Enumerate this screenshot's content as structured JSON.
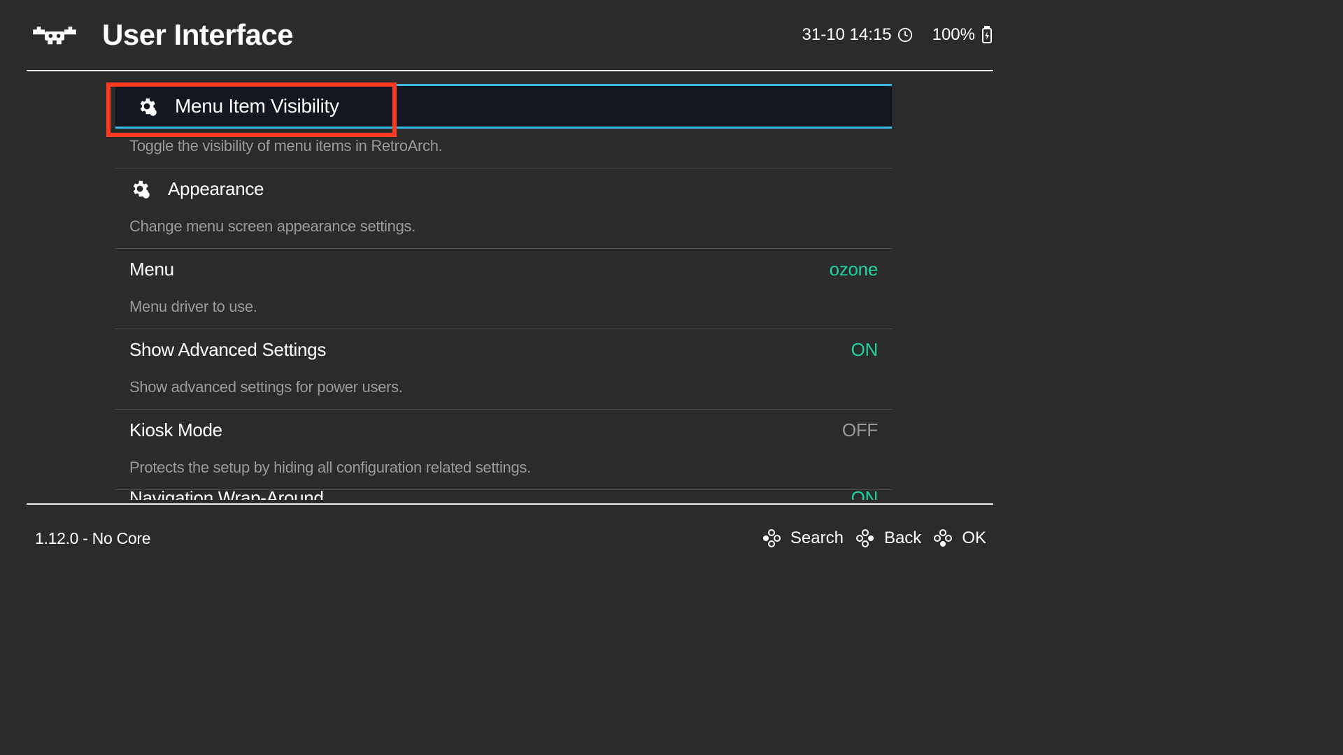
{
  "header": {
    "title": "User Interface",
    "datetime": "31-10 14:15",
    "battery_pct": "100%"
  },
  "items": [
    {
      "label": "Menu Item Visibility",
      "icon": "settings-icon",
      "desc": "Toggle the visibility of menu items in RetroArch.",
      "value": "",
      "value_class": ""
    },
    {
      "label": "Appearance",
      "icon": "settings-icon",
      "desc": "Change menu screen appearance settings.",
      "value": "",
      "value_class": ""
    },
    {
      "label": "Menu",
      "icon": "",
      "desc": "Menu driver to use.",
      "value": "ozone",
      "value_class": "green"
    },
    {
      "label": "Show Advanced Settings",
      "icon": "",
      "desc": "Show advanced settings for power users.",
      "value": "ON",
      "value_class": "green"
    },
    {
      "label": "Kiosk Mode",
      "icon": "",
      "desc": "Protects the setup by hiding all configuration related settings.",
      "value": "OFF",
      "value_class": "grey"
    },
    {
      "label": "Navigation Wrap-Around",
      "icon": "",
      "desc": "",
      "value": "ON",
      "value_class": "green"
    }
  ],
  "footer": {
    "version": "1.12.0 - No Core",
    "hints": [
      {
        "label": "Search"
      },
      {
        "label": "Back"
      },
      {
        "label": "OK"
      }
    ]
  },
  "colors": {
    "accent": "#1fd1a1",
    "select_border": "#3bb4e6",
    "highlight": "#ff3b1f"
  }
}
